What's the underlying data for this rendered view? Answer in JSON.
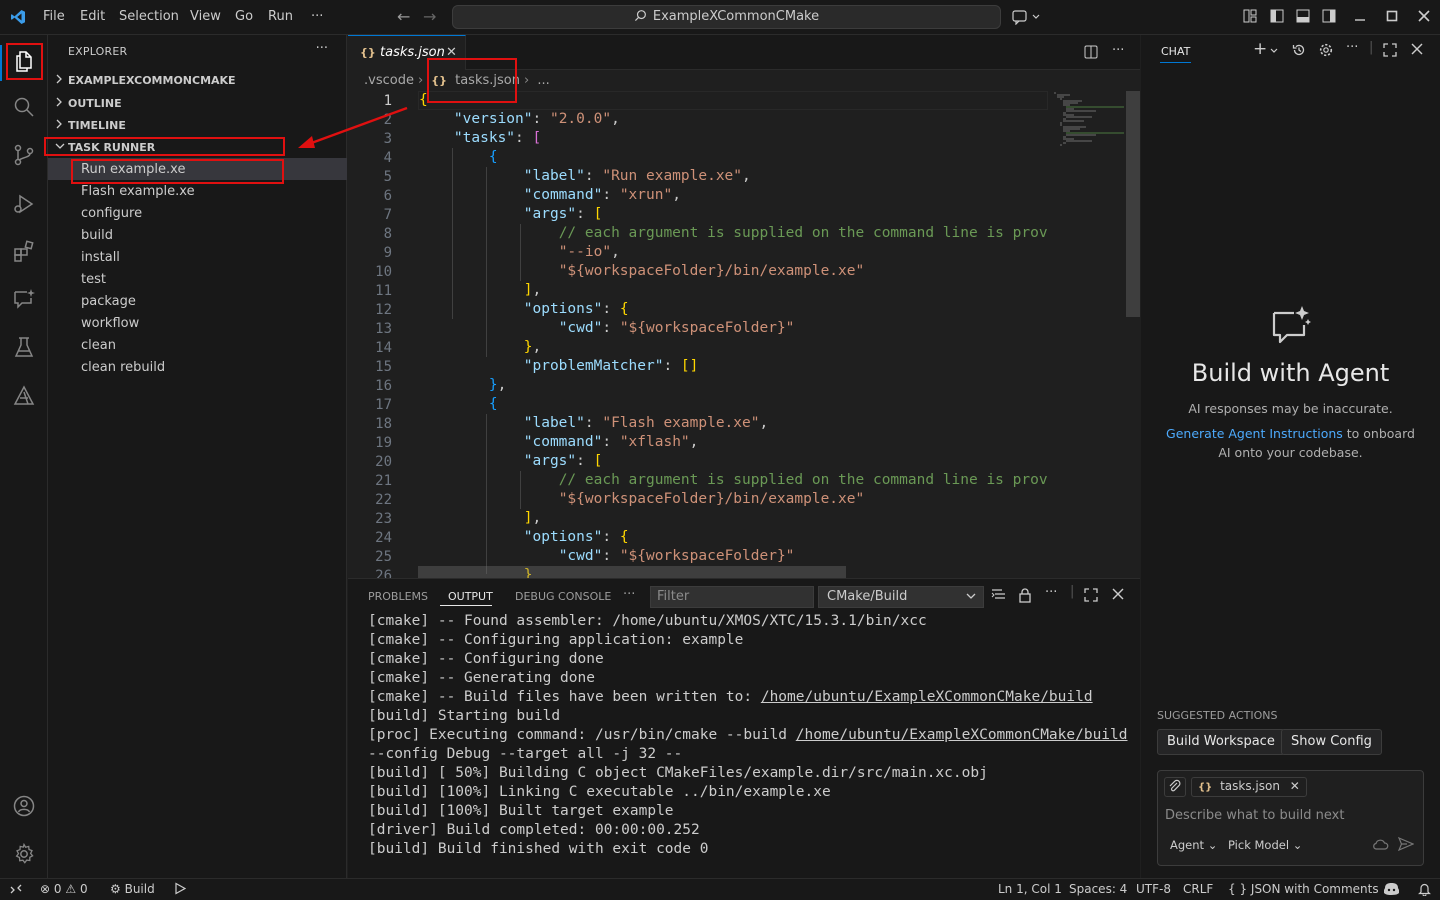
{
  "titlebar": {
    "menus": [
      "File",
      "Edit",
      "Selection",
      "View",
      "Go",
      "Run",
      "···"
    ],
    "command_center": "ExampleXCommonCMake"
  },
  "sidebar": {
    "title": "EXPLORER",
    "sections": [
      {
        "label": "EXAMPLEXCOMMONCMAKE",
        "expanded": false
      },
      {
        "label": "OUTLINE",
        "expanded": false
      },
      {
        "label": "TIMELINE",
        "expanded": false
      },
      {
        "label": "TASK RUNNER",
        "expanded": true
      }
    ],
    "tasks": [
      "Run example.xe",
      "Flash example.xe",
      "configure",
      "build",
      "install",
      "test",
      "package",
      "workflow",
      "clean",
      "clean rebuild"
    ]
  },
  "editor": {
    "tab_label": "tasks.json",
    "breadcrumb": [
      ".vscode",
      "tasks.json",
      "..."
    ],
    "line_numbers": [
      "1",
      "2",
      "3",
      "4",
      "5",
      "6",
      "7",
      "8",
      "9",
      "10",
      "11",
      "12",
      "13",
      "14",
      "15",
      "16",
      "17",
      "18",
      "19",
      "20",
      "21",
      "22",
      "23",
      "24",
      "25",
      "26"
    ],
    "code": {
      "version_key": "\"version\"",
      "version_val": "\"2.0.0\"",
      "tasks_key": "\"tasks\"",
      "label_key": "\"label\"",
      "label1": "\"Run example.xe\"",
      "label2": "\"Flash example.xe\"",
      "command_key": "\"command\"",
      "command1": "\"xrun\"",
      "command2": "\"xflash\"",
      "args_key": "\"args\"",
      "comment": "// each argument is supplied on the command line is provid",
      "io_arg": "\"--io\"",
      "bin_arg": "\"${workspaceFolder}/bin/example.xe\"",
      "options_key": "\"options\"",
      "cwd_key": "\"cwd\"",
      "cwd_val": "\"${workspaceFolder}\"",
      "pm_key": "\"problemMatcher\""
    }
  },
  "panel": {
    "tabs": [
      "PROBLEMS",
      "OUTPUT",
      "DEBUG CONSOLE",
      "···"
    ],
    "active_tab": "OUTPUT",
    "filter_placeholder": "Filter",
    "channel": "CMake/Build",
    "lines": [
      "[cmake] -- Found assembler: /home/ubuntu/XMOS/XTC/15.3.1/bin/xcc",
      "[cmake] -- Configuring application: example",
      "[cmake] -- Configuring done",
      "[cmake] -- Generating done",
      "[cmake] -- Build files have been written to: ",
      "[build] Starting build",
      "[proc] Executing command: /usr/bin/cmake --build ",
      "--config Debug --target all -j 32 --",
      "[build] [ 50%] Building C object CMakeFiles/example.dir/src/main.xc.obj",
      "[build] [100%] Linking C executable ../bin/example.xe",
      "[build] [100%] Built target example",
      "[driver] Build completed: 00:00:00.252",
      "[build] Build finished with exit code 0"
    ],
    "build_path": "/home/ubuntu/ExampleXCommonCMake/build"
  },
  "chat": {
    "title": "CHAT",
    "hero_title": "Build with Agent",
    "disclaimer": "AI responses may be inaccurate.",
    "onboard_link": "Generate Agent Instructions",
    "onboard_rest": " to onboard AI onto your codebase.",
    "suggested_header": "SUGGESTED ACTIONS",
    "suggested": [
      "Build Workspace",
      "Show Config"
    ],
    "attachment": "tasks.json",
    "input_placeholder": "Describe what to build next",
    "mode": "Agent",
    "model": "Pick Model"
  },
  "statusbar": {
    "errors": "0",
    "warnings": "0",
    "build": "Build",
    "position": "Ln 1, Col 1",
    "spaces": "Spaces: 4",
    "encoding": "UTF-8",
    "eol": "CRLF",
    "language": "{ }  JSON with Comments"
  },
  "colors": {
    "accent": "#0078d4",
    "annotation": "#e01010"
  }
}
